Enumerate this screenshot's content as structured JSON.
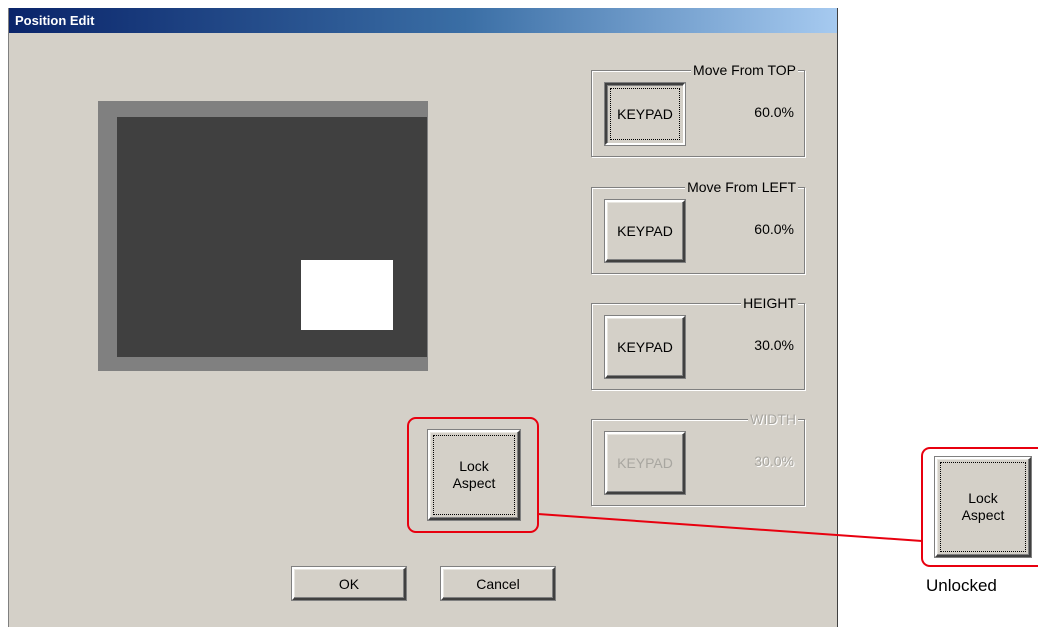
{
  "dialog": {
    "title": "Position Edit"
  },
  "groups": {
    "top": {
      "label": "Move From TOP",
      "button": "KEYPAD",
      "value": "60.0%"
    },
    "left": {
      "label": "Move From LEFT",
      "button": "KEYPAD",
      "value": "60.0%"
    },
    "height": {
      "label": "HEIGHT",
      "button": "KEYPAD",
      "value": "30.0%"
    },
    "width": {
      "label": "WIDTH",
      "button": "KEYPAD",
      "value": "30.0%"
    }
  },
  "lock_aspect": {
    "line1": "Lock",
    "line2": "Aspect"
  },
  "footer": {
    "ok_label": "OK",
    "cancel_label": "Cancel"
  },
  "annotation": {
    "lock_line1": "Lock",
    "lock_line2": "Aspect",
    "state_label": "Unlocked",
    "callout_color": "#e8000f"
  }
}
